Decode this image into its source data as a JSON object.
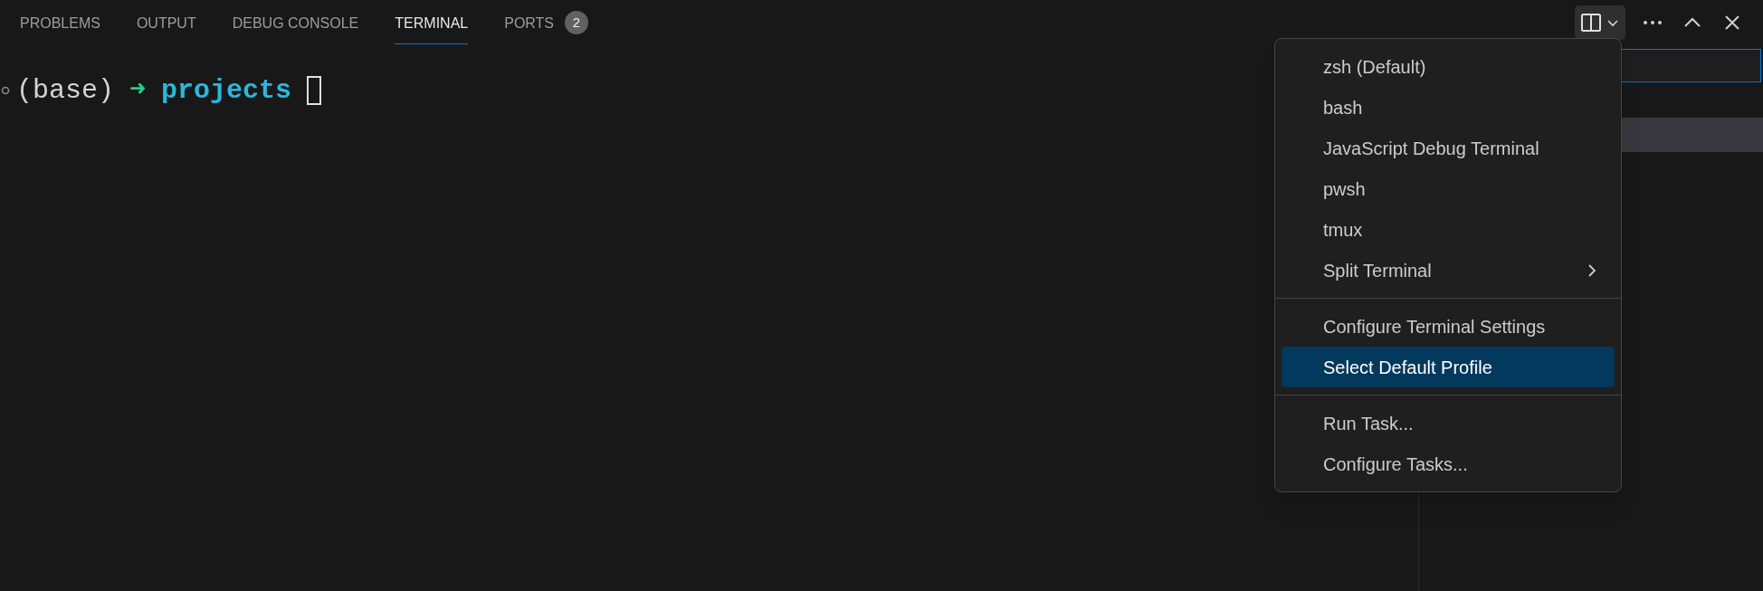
{
  "tabs": [
    {
      "label": "PROBLEMS",
      "selected": false
    },
    {
      "label": "OUTPUT",
      "selected": false
    },
    {
      "label": "DEBUG CONSOLE",
      "selected": false
    },
    {
      "label": "TERMINAL",
      "selected": true
    },
    {
      "label": "PORTS",
      "selected": false,
      "badge": "2"
    }
  ],
  "terminal": {
    "env": "(base)",
    "arrow": "➜",
    "directory": "projects"
  },
  "menu": {
    "groups": [
      [
        {
          "label": "zsh (Default)",
          "selected": false,
          "submenu": false
        },
        {
          "label": "bash",
          "selected": false,
          "submenu": false
        },
        {
          "label": "JavaScript Debug Terminal",
          "selected": false,
          "submenu": false
        },
        {
          "label": "pwsh",
          "selected": false,
          "submenu": false
        },
        {
          "label": "tmux",
          "selected": false,
          "submenu": false
        },
        {
          "label": "Split Terminal",
          "selected": false,
          "submenu": true
        }
      ],
      [
        {
          "label": "Configure Terminal Settings",
          "selected": false,
          "submenu": false
        },
        {
          "label": "Select Default Profile",
          "selected": true,
          "submenu": false
        }
      ],
      [
        {
          "label": "Run Task...",
          "selected": false,
          "submenu": false
        },
        {
          "label": "Configure Tasks...",
          "selected": false,
          "submenu": false
        }
      ]
    ]
  }
}
